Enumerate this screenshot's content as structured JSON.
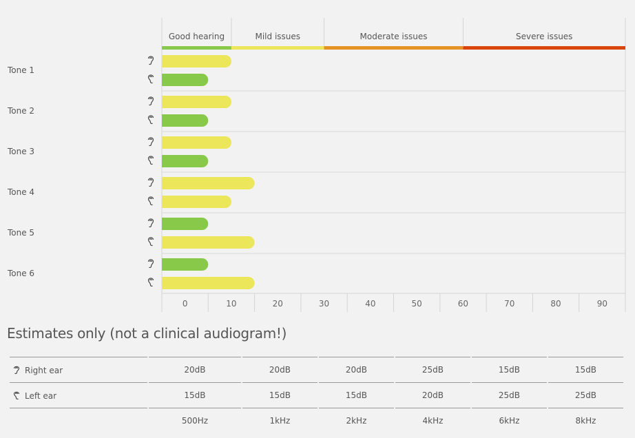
{
  "chart_data": {
    "type": "bar",
    "orientation": "horizontal",
    "categories": [
      "Tone 1",
      "Tone 2",
      "Tone 3",
      "Tone 4",
      "Tone 5",
      "Tone 6"
    ],
    "series": [
      {
        "name": "Right ear",
        "icon": "right-ear-icon",
        "values": [
          15,
          15,
          15,
          20,
          10,
          10
        ]
      },
      {
        "name": "Left ear",
        "icon": "left-ear-icon",
        "values": [
          10,
          10,
          10,
          15,
          20,
          20
        ]
      }
    ],
    "xlim": [
      0,
      100
    ],
    "xticks": [
      0,
      10,
      20,
      30,
      40,
      50,
      60,
      70,
      80,
      90
    ],
    "grid": true,
    "zones": [
      {
        "label": "Good hearing",
        "from": 0,
        "to": 15,
        "color": "#88c94a"
      },
      {
        "label": "Mild issues",
        "from": 15,
        "to": 35,
        "color": "#ebe65a"
      },
      {
        "label": "Moderate issues",
        "from": 35,
        "to": 65,
        "color": "#e69325"
      },
      {
        "label": "Severe issues",
        "from": 65,
        "to": 100,
        "color": "#d9450b"
      }
    ],
    "title": "Estimates only (not a clinical audiogram!)",
    "xlabel": "",
    "ylabel": ""
  },
  "table": {
    "rows": [
      {
        "label": "Right ear",
        "icon": "right-ear-icon",
        "values": [
          "20dB",
          "20dB",
          "20dB",
          "25dB",
          "15dB",
          "15dB"
        ]
      },
      {
        "label": "Left ear",
        "icon": "left-ear-icon",
        "values": [
          "15dB",
          "15dB",
          "15dB",
          "20dB",
          "25dB",
          "25dB"
        ]
      }
    ],
    "frequencies": [
      "500Hz",
      "1kHz",
      "2kHz",
      "4kHz",
      "6kHz",
      "8kHz"
    ]
  }
}
